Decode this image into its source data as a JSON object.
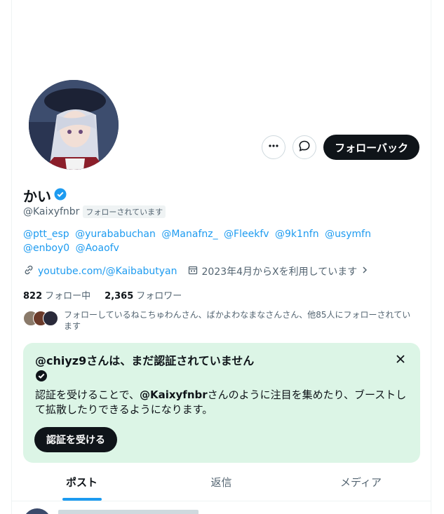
{
  "profile": {
    "name": "かい",
    "handle": "@Kaixyfnbr",
    "follows_you": "フォローされています",
    "bio_mentions": [
      "@ptt_esp",
      "@yurababuchan",
      "@Manafnz_",
      "@Fleekfv",
      "@9k1nfn",
      "@usymfn",
      "@enboy0",
      "@Aoaofv"
    ],
    "link": "youtube.com/@Kaibabutyan",
    "joined": "2023年4月からXを利用しています",
    "following_count": "822",
    "following_label": "フォロー中",
    "followers_count": "2,365",
    "followers_label": "フォロワー",
    "followed_by_text": "フォローしているねこちゅわんさん、ばかよわなまなさんさん、他85人にフォローされています"
  },
  "actions": {
    "more_icon": "more-icon",
    "message_icon": "message-icon",
    "follow_back_label": "フォローバック"
  },
  "verify_card": {
    "title": "@chiyz9さんは、まだ認証されていません",
    "body_prefix": "認証を受けることで、",
    "body_handle": "@Kaixyfnbr",
    "body_suffix": "さんのように注目を集めたり、ブーストして拡散したりできるようになります。",
    "button_label": "認証を受ける"
  },
  "tabs": [
    {
      "label": "ポスト",
      "active": true
    },
    {
      "label": "返信",
      "active": false
    },
    {
      "label": "メディア",
      "active": false
    }
  ],
  "colors": {
    "accent": "#1d9bf0",
    "verify_bg": "#dcf5e6",
    "dark": "#0f1419",
    "muted": "#536471"
  }
}
